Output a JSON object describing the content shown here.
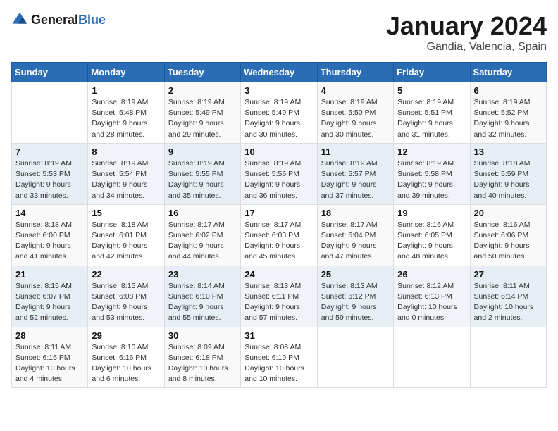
{
  "header": {
    "logo_general": "General",
    "logo_blue": "Blue",
    "month_year": "January 2024",
    "location": "Gandia, Valencia, Spain"
  },
  "weekdays": [
    "Sunday",
    "Monday",
    "Tuesday",
    "Wednesday",
    "Thursday",
    "Friday",
    "Saturday"
  ],
  "weeks": [
    [
      {
        "day": "",
        "sunrise": "",
        "sunset": "",
        "daylight": ""
      },
      {
        "day": "1",
        "sunrise": "Sunrise: 8:19 AM",
        "sunset": "Sunset: 5:48 PM",
        "daylight": "Daylight: 9 hours and 28 minutes."
      },
      {
        "day": "2",
        "sunrise": "Sunrise: 8:19 AM",
        "sunset": "Sunset: 5:49 PM",
        "daylight": "Daylight: 9 hours and 29 minutes."
      },
      {
        "day": "3",
        "sunrise": "Sunrise: 8:19 AM",
        "sunset": "Sunset: 5:49 PM",
        "daylight": "Daylight: 9 hours and 30 minutes."
      },
      {
        "day": "4",
        "sunrise": "Sunrise: 8:19 AM",
        "sunset": "Sunset: 5:50 PM",
        "daylight": "Daylight: 9 hours and 30 minutes."
      },
      {
        "day": "5",
        "sunrise": "Sunrise: 8:19 AM",
        "sunset": "Sunset: 5:51 PM",
        "daylight": "Daylight: 9 hours and 31 minutes."
      },
      {
        "day": "6",
        "sunrise": "Sunrise: 8:19 AM",
        "sunset": "Sunset: 5:52 PM",
        "daylight": "Daylight: 9 hours and 32 minutes."
      }
    ],
    [
      {
        "day": "7",
        "sunrise": "Sunrise: 8:19 AM",
        "sunset": "Sunset: 5:53 PM",
        "daylight": "Daylight: 9 hours and 33 minutes."
      },
      {
        "day": "8",
        "sunrise": "Sunrise: 8:19 AM",
        "sunset": "Sunset: 5:54 PM",
        "daylight": "Daylight: 9 hours and 34 minutes."
      },
      {
        "day": "9",
        "sunrise": "Sunrise: 8:19 AM",
        "sunset": "Sunset: 5:55 PM",
        "daylight": "Daylight: 9 hours and 35 minutes."
      },
      {
        "day": "10",
        "sunrise": "Sunrise: 8:19 AM",
        "sunset": "Sunset: 5:56 PM",
        "daylight": "Daylight: 9 hours and 36 minutes."
      },
      {
        "day": "11",
        "sunrise": "Sunrise: 8:19 AM",
        "sunset": "Sunset: 5:57 PM",
        "daylight": "Daylight: 9 hours and 37 minutes."
      },
      {
        "day": "12",
        "sunrise": "Sunrise: 8:19 AM",
        "sunset": "Sunset: 5:58 PM",
        "daylight": "Daylight: 9 hours and 39 minutes."
      },
      {
        "day": "13",
        "sunrise": "Sunrise: 8:18 AM",
        "sunset": "Sunset: 5:59 PM",
        "daylight": "Daylight: 9 hours and 40 minutes."
      }
    ],
    [
      {
        "day": "14",
        "sunrise": "Sunrise: 8:18 AM",
        "sunset": "Sunset: 6:00 PM",
        "daylight": "Daylight: 9 hours and 41 minutes."
      },
      {
        "day": "15",
        "sunrise": "Sunrise: 8:18 AM",
        "sunset": "Sunset: 6:01 PM",
        "daylight": "Daylight: 9 hours and 42 minutes."
      },
      {
        "day": "16",
        "sunrise": "Sunrise: 8:17 AM",
        "sunset": "Sunset: 6:02 PM",
        "daylight": "Daylight: 9 hours and 44 minutes."
      },
      {
        "day": "17",
        "sunrise": "Sunrise: 8:17 AM",
        "sunset": "Sunset: 6:03 PM",
        "daylight": "Daylight: 9 hours and 45 minutes."
      },
      {
        "day": "18",
        "sunrise": "Sunrise: 8:17 AM",
        "sunset": "Sunset: 6:04 PM",
        "daylight": "Daylight: 9 hours and 47 minutes."
      },
      {
        "day": "19",
        "sunrise": "Sunrise: 8:16 AM",
        "sunset": "Sunset: 6:05 PM",
        "daylight": "Daylight: 9 hours and 48 minutes."
      },
      {
        "day": "20",
        "sunrise": "Sunrise: 8:16 AM",
        "sunset": "Sunset: 6:06 PM",
        "daylight": "Daylight: 9 hours and 50 minutes."
      }
    ],
    [
      {
        "day": "21",
        "sunrise": "Sunrise: 8:15 AM",
        "sunset": "Sunset: 6:07 PM",
        "daylight": "Daylight: 9 hours and 52 minutes."
      },
      {
        "day": "22",
        "sunrise": "Sunrise: 8:15 AM",
        "sunset": "Sunset: 6:08 PM",
        "daylight": "Daylight: 9 hours and 53 minutes."
      },
      {
        "day": "23",
        "sunrise": "Sunrise: 8:14 AM",
        "sunset": "Sunset: 6:10 PM",
        "daylight": "Daylight: 9 hours and 55 minutes."
      },
      {
        "day": "24",
        "sunrise": "Sunrise: 8:13 AM",
        "sunset": "Sunset: 6:11 PM",
        "daylight": "Daylight: 9 hours and 57 minutes."
      },
      {
        "day": "25",
        "sunrise": "Sunrise: 8:13 AM",
        "sunset": "Sunset: 6:12 PM",
        "daylight": "Daylight: 9 hours and 59 minutes."
      },
      {
        "day": "26",
        "sunrise": "Sunrise: 8:12 AM",
        "sunset": "Sunset: 6:13 PM",
        "daylight": "Daylight: 10 hours and 0 minutes."
      },
      {
        "day": "27",
        "sunrise": "Sunrise: 8:11 AM",
        "sunset": "Sunset: 6:14 PM",
        "daylight": "Daylight: 10 hours and 2 minutes."
      }
    ],
    [
      {
        "day": "28",
        "sunrise": "Sunrise: 8:11 AM",
        "sunset": "Sunset: 6:15 PM",
        "daylight": "Daylight: 10 hours and 4 minutes."
      },
      {
        "day": "29",
        "sunrise": "Sunrise: 8:10 AM",
        "sunset": "Sunset: 6:16 PM",
        "daylight": "Daylight: 10 hours and 6 minutes."
      },
      {
        "day": "30",
        "sunrise": "Sunrise: 8:09 AM",
        "sunset": "Sunset: 6:18 PM",
        "daylight": "Daylight: 10 hours and 8 minutes."
      },
      {
        "day": "31",
        "sunrise": "Sunrise: 8:08 AM",
        "sunset": "Sunset: 6:19 PM",
        "daylight": "Daylight: 10 hours and 10 minutes."
      },
      {
        "day": "",
        "sunrise": "",
        "sunset": "",
        "daylight": ""
      },
      {
        "day": "",
        "sunrise": "",
        "sunset": "",
        "daylight": ""
      },
      {
        "day": "",
        "sunrise": "",
        "sunset": "",
        "daylight": ""
      }
    ]
  ]
}
